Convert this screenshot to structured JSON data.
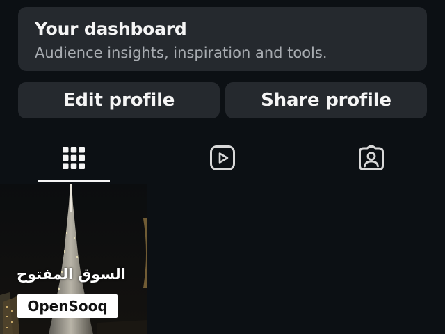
{
  "dashboard": {
    "title": "Your dashboard",
    "subtitle": "Audience insights, inspiration and tools."
  },
  "actions": {
    "edit_label": "Edit profile",
    "share_label": "Share profile"
  },
  "tabs": [
    {
      "icon": "grid-icon",
      "selected": true
    },
    {
      "icon": "reels-icon",
      "selected": false
    },
    {
      "icon": "tagged-icon",
      "selected": false
    }
  ],
  "post": {
    "watermark_arabic": "السوق المفتوح",
    "watermark_brand": "OpenSooq"
  },
  "colors": {
    "background": "#0c1014",
    "card": "#25292e",
    "text": "#f5f5f5",
    "subtext": "#a8acb1"
  }
}
